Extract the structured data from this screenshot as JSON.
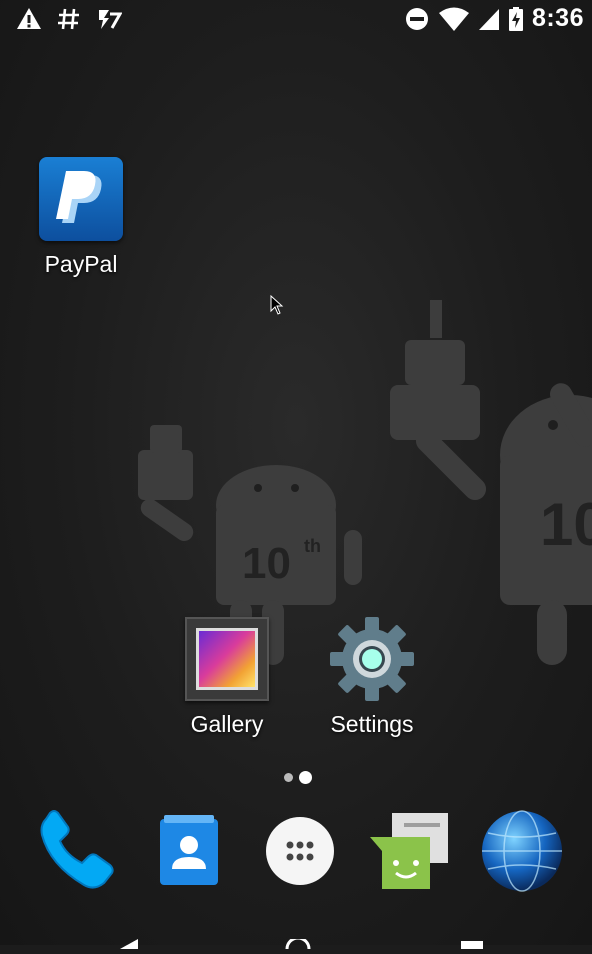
{
  "status_bar": {
    "time": "8:36",
    "left_icons": [
      "warning-icon",
      "hashtag-icon",
      "notification-icon"
    ],
    "right_icons": [
      "do-not-disturb-icon",
      "wifi-icon",
      "signal-icon",
      "battery-charging-icon"
    ]
  },
  "home": {
    "apps": [
      {
        "label": "PayPal",
        "icon": "paypal-icon"
      },
      {
        "label": "Gallery",
        "icon": "gallery-icon"
      },
      {
        "label": "Settings",
        "icon": "settings-gear-icon"
      }
    ],
    "page_count": 2,
    "active_page": 2
  },
  "dock": {
    "items": [
      "phone-icon",
      "contacts-icon",
      "app-drawer-icon",
      "messaging-icon",
      "browser-globe-icon"
    ]
  },
  "navigation": {
    "buttons": [
      "back-icon",
      "home-icon",
      "recents-icon"
    ]
  },
  "colors": {
    "paypal_blue": "#1a7fd4",
    "wallpaper": "#1c1c1c",
    "messaging_green": "#8bc34a",
    "contacts_blue": "#1e88e5",
    "phone_blue": "#03a9f4"
  }
}
